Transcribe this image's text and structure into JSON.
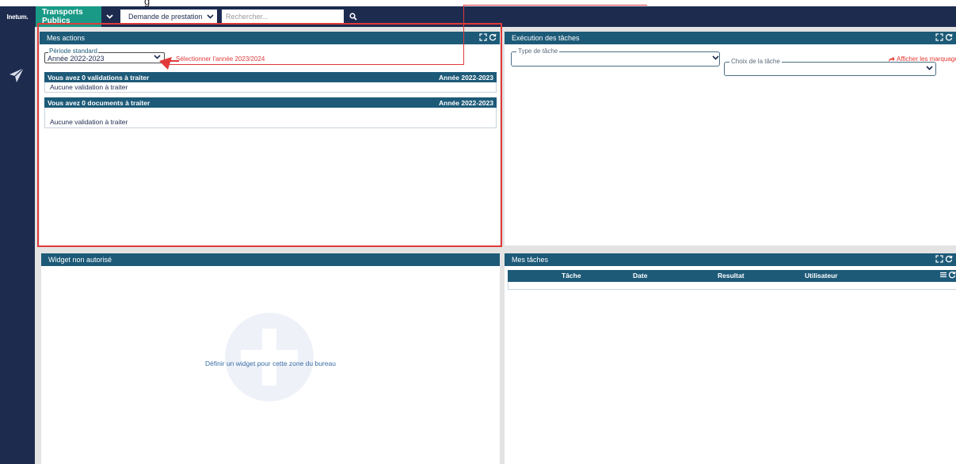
{
  "topbar": {
    "logo": "Inetum.",
    "brand": "Transports Publics",
    "service_select": "Demande de prestation",
    "search_placeholder": "Rechercher..."
  },
  "panels": {
    "actions": {
      "title": "Mes actions",
      "periode": {
        "legend": "Période standard",
        "value": "Année 2022-2023"
      },
      "sections": [
        {
          "title": "Vous avez 0 validations à traiter",
          "year": "Année 2022-2023",
          "body": "Aucune validation à traiter"
        },
        {
          "title": "Vous avez 0 documents à traiter",
          "year": "Année 2022-2023",
          "body": "Aucune validation à traiter"
        }
      ]
    },
    "execution": {
      "title": "Exécution des tâches",
      "type_legend": "Type de tâche",
      "choix_legend": "Choix de la tâche",
      "marquages_link": "Afficher les marquages"
    },
    "widget": {
      "title": "Widget non autorisé",
      "define_text": "Définir un widget pour cette zone du bureau"
    },
    "tasks": {
      "title": "Mes tâches",
      "columns": [
        "Tâche",
        "Date",
        "Resultat",
        "Utilisateur"
      ]
    }
  },
  "annotation": {
    "text": "Sélectionner l'année 2023/2024",
    "clipped_top_text": "g",
    "color": "#e03a3a"
  },
  "colors": {
    "navy": "#1d2b4f",
    "teal_brand": "#199a87",
    "panel_header": "#1d5a78"
  },
  "icons": [
    "chevron-down-icon",
    "search-icon",
    "send-icon",
    "expand-icon",
    "refresh-icon",
    "share-icon",
    "menu-icon",
    "plus-icon"
  ]
}
